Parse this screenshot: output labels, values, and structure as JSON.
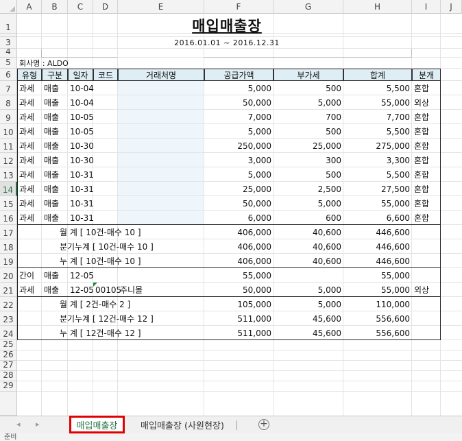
{
  "columns": [
    "A",
    "B",
    "C",
    "D",
    "E",
    "F",
    "G",
    "H",
    "I",
    "J"
  ],
  "rows": [
    "1",
    "2",
    "3",
    "4",
    "5",
    "6",
    "7",
    "8",
    "9",
    "10",
    "11",
    "12",
    "13",
    "14",
    "15",
    "16",
    "17",
    "18",
    "19",
    "20",
    "21",
    "22",
    "23",
    "24",
    "25",
    "26",
    "27",
    "28",
    "29"
  ],
  "selected_row": "14",
  "report": {
    "title": "매입매출장",
    "period": "2016.01.01 ~ 2016.12.31",
    "company": "회사명 : ALDO"
  },
  "headers": [
    "유형",
    "구분",
    "일자",
    "코드",
    "거래처명",
    "공급가액",
    "부가세",
    "합계",
    "분개"
  ],
  "rows_data": [
    {
      "type": "과세",
      "kind": "매출",
      "date": "10-04",
      "code": "",
      "name": "",
      "supply": "5,000",
      "vat": "500",
      "total": "5,500",
      "entry": "혼합"
    },
    {
      "type": "과세",
      "kind": "매출",
      "date": "10-04",
      "code": "",
      "name": "",
      "supply": "50,000",
      "vat": "5,000",
      "total": "55,000",
      "entry": "외상"
    },
    {
      "type": "과세",
      "kind": "매출",
      "date": "10-05",
      "code": "",
      "name": "",
      "supply": "7,000",
      "vat": "700",
      "total": "7,700",
      "entry": "혼합"
    },
    {
      "type": "과세",
      "kind": "매출",
      "date": "10-05",
      "code": "",
      "name": "",
      "supply": "5,000",
      "vat": "500",
      "total": "5,500",
      "entry": "혼합"
    },
    {
      "type": "과세",
      "kind": "매출",
      "date": "10-30",
      "code": "",
      "name": "",
      "supply": "250,000",
      "vat": "25,000",
      "total": "275,000",
      "entry": "혼합"
    },
    {
      "type": "과세",
      "kind": "매출",
      "date": "10-30",
      "code": "",
      "name": "",
      "supply": "3,000",
      "vat": "300",
      "total": "3,300",
      "entry": "혼합"
    },
    {
      "type": "과세",
      "kind": "매출",
      "date": "10-31",
      "code": "",
      "name": "",
      "supply": "5,000",
      "vat": "500",
      "total": "5,500",
      "entry": "혼합"
    },
    {
      "type": "과세",
      "kind": "매출",
      "date": "10-31",
      "code": "",
      "name": "",
      "supply": "25,000",
      "vat": "2,500",
      "total": "27,500",
      "entry": "혼합"
    },
    {
      "type": "과세",
      "kind": "매출",
      "date": "10-31",
      "code": "",
      "name": "",
      "supply": "50,000",
      "vat": "5,000",
      "total": "55,000",
      "entry": "혼합"
    },
    {
      "type": "과세",
      "kind": "매출",
      "date": "10-31",
      "code": "",
      "name": "",
      "supply": "6,000",
      "vat": "600",
      "total": "6,600",
      "entry": "혼합"
    }
  ],
  "subtotals1": [
    {
      "label": "월    계 [ 10건-매수 10 ]",
      "supply": "406,000",
      "vat": "40,600",
      "total": "446,600"
    },
    {
      "label": "분기누계 [ 10건-매수 10 ]",
      "supply": "406,000",
      "vat": "40,600",
      "total": "446,600"
    },
    {
      "label": "누    계 [ 10건-매수 10 ]",
      "supply": "406,000",
      "vat": "40,600",
      "total": "446,600"
    }
  ],
  "rows_data2": [
    {
      "type": "간이",
      "kind": "매출",
      "date": "12-05",
      "code": "",
      "name": "",
      "supply": "55,000",
      "vat": "",
      "total": "55,000",
      "entry": ""
    },
    {
      "type": "과세",
      "kind": "매출",
      "date": "12-05",
      "code": "00105",
      "name": "주니몰",
      "supply": "50,000",
      "vat": "5,000",
      "total": "55,000",
      "entry": "외상"
    }
  ],
  "subtotals2": [
    {
      "label": "월    계 [ 2건-매수 2 ]",
      "supply": "105,000",
      "vat": "5,000",
      "total": "110,000"
    },
    {
      "label": "분기누계 [ 12건-매수 12 ]",
      "supply": "511,000",
      "vat": "45,600",
      "total": "556,600"
    },
    {
      "label": "누    계 [ 12건-매수 12 ]",
      "supply": "511,000",
      "vat": "45,600",
      "total": "556,600"
    }
  ],
  "tabs": {
    "active": "매입매출장",
    "second": "매입매출장 (사원현장)",
    "prev_icon": "◂",
    "next_icon": "▸",
    "add_icon": "+"
  },
  "status": "준비"
}
